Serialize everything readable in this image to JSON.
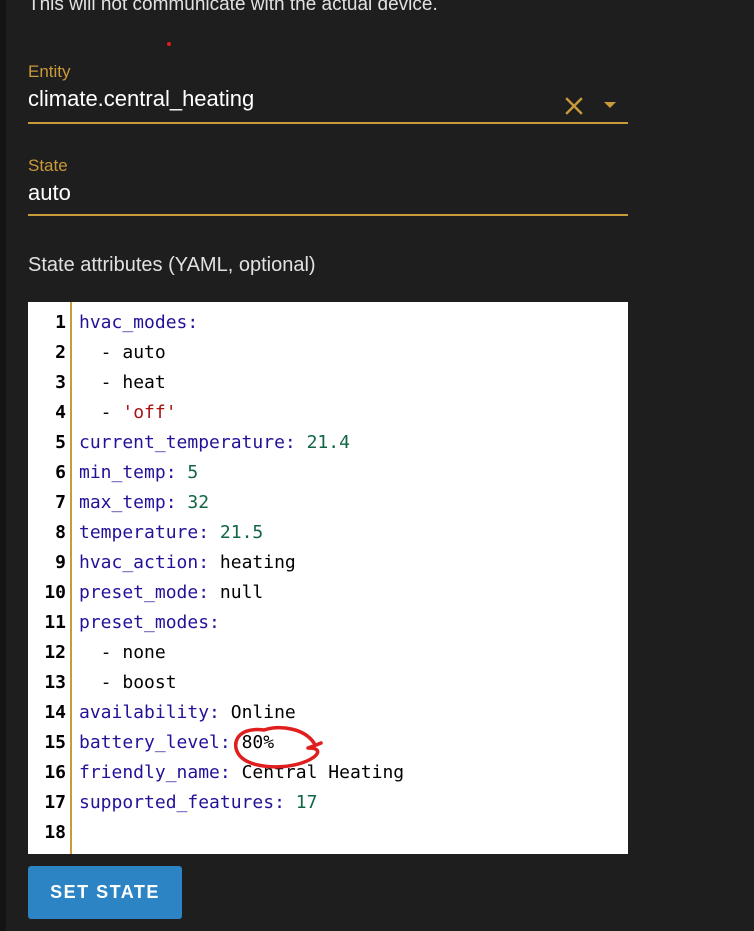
{
  "intro_text": "This will not communicate with the actual device.",
  "entity": {
    "label": "Entity",
    "value": "climate.central_heating"
  },
  "state": {
    "label": "State",
    "value": "auto"
  },
  "attributes_label": "State attributes (YAML, optional)",
  "editor": {
    "lines": [
      {
        "n": "1",
        "parts": [
          {
            "t": "hvac_modes",
            "c": "k"
          },
          {
            "t": ":",
            "c": "k"
          }
        ]
      },
      {
        "n": "2",
        "parts": [
          {
            "t": "  - ",
            "c": "p"
          },
          {
            "t": "auto",
            "c": "p"
          }
        ]
      },
      {
        "n": "3",
        "parts": [
          {
            "t": "  - ",
            "c": "p"
          },
          {
            "t": "heat",
            "c": "p"
          }
        ]
      },
      {
        "n": "4",
        "parts": [
          {
            "t": "  - ",
            "c": "p"
          },
          {
            "t": "'off'",
            "c": "s"
          }
        ]
      },
      {
        "n": "5",
        "parts": [
          {
            "t": "current_temperature",
            "c": "k"
          },
          {
            "t": ": ",
            "c": "k"
          },
          {
            "t": "21.4",
            "c": "n"
          }
        ]
      },
      {
        "n": "6",
        "parts": [
          {
            "t": "min_temp",
            "c": "k"
          },
          {
            "t": ": ",
            "c": "k"
          },
          {
            "t": "5",
            "c": "n"
          }
        ]
      },
      {
        "n": "7",
        "parts": [
          {
            "t": "max_temp",
            "c": "k"
          },
          {
            "t": ": ",
            "c": "k"
          },
          {
            "t": "32",
            "c": "n"
          }
        ]
      },
      {
        "n": "8",
        "parts": [
          {
            "t": "temperature",
            "c": "k"
          },
          {
            "t": ": ",
            "c": "k"
          },
          {
            "t": "21.5",
            "c": "n"
          }
        ]
      },
      {
        "n": "9",
        "parts": [
          {
            "t": "hvac_action",
            "c": "k"
          },
          {
            "t": ": ",
            "c": "k"
          },
          {
            "t": "heating",
            "c": "p"
          }
        ]
      },
      {
        "n": "10",
        "parts": [
          {
            "t": "preset_mode",
            "c": "k"
          },
          {
            "t": ": ",
            "c": "k"
          },
          {
            "t": "null",
            "c": "p"
          }
        ]
      },
      {
        "n": "11",
        "parts": [
          {
            "t": "preset_modes",
            "c": "k"
          },
          {
            "t": ":",
            "c": "k"
          }
        ]
      },
      {
        "n": "12",
        "parts": [
          {
            "t": "  - ",
            "c": "p"
          },
          {
            "t": "none",
            "c": "p"
          }
        ]
      },
      {
        "n": "13",
        "parts": [
          {
            "t": "  - ",
            "c": "p"
          },
          {
            "t": "boost",
            "c": "p"
          }
        ]
      },
      {
        "n": "14",
        "parts": [
          {
            "t": "availability",
            "c": "k"
          },
          {
            "t": ": ",
            "c": "k"
          },
          {
            "t": "Online",
            "c": "p"
          }
        ]
      },
      {
        "n": "15",
        "parts": [
          {
            "t": "battery_level",
            "c": "k"
          },
          {
            "t": ": ",
            "c": "k"
          },
          {
            "t": "80%",
            "c": "p"
          }
        ]
      },
      {
        "n": "16",
        "parts": [
          {
            "t": "friendly_name",
            "c": "k"
          },
          {
            "t": ": ",
            "c": "k"
          },
          {
            "t": "Central Heating",
            "c": "p"
          }
        ]
      },
      {
        "n": "17",
        "parts": [
          {
            "t": "supported_features",
            "c": "k"
          },
          {
            "t": ": ",
            "c": "k"
          },
          {
            "t": "17",
            "c": "n"
          }
        ]
      },
      {
        "n": "18",
        "parts": []
      }
    ]
  },
  "button": {
    "label": "SET STATE"
  },
  "colors": {
    "accent": "#c99a3a",
    "button": "#2d84c4",
    "annotation": "#e01e1e",
    "yaml_key": "#221199",
    "yaml_number": "#116644",
    "yaml_string": "#aa1111"
  },
  "icons": {
    "clear": "close-icon",
    "dropdown": "caret-down-icon"
  }
}
